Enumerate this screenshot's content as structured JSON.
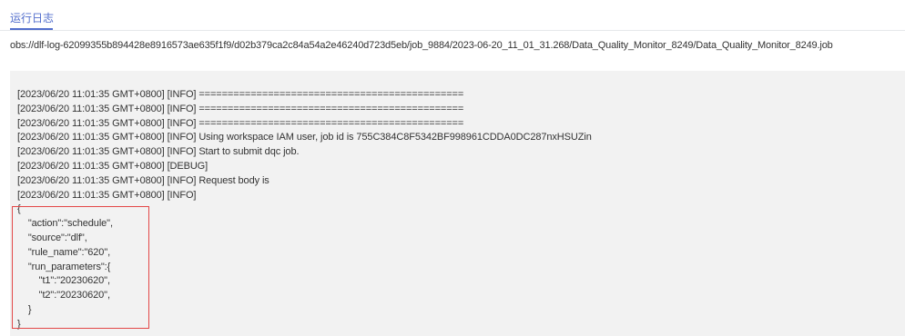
{
  "tabs": {
    "active_label": "运行日志"
  },
  "log_path": "obs://dlf-log-62099355b894428e8916573ae635f1f9/d02b379ca2c84a54a2e46240d723d5eb/job_9884/2023-06-20_11_01_31.268/Data_Quality_Monitor_8249/Data_Quality_Monitor_8249.job",
  "log_lines": [
    "[2023/06/20 11:01:35 GMT+0800] [INFO] ==============================================",
    "[2023/06/20 11:01:35 GMT+0800] [INFO] ==============================================",
    "[2023/06/20 11:01:35 GMT+0800] [INFO] ==============================================",
    "[2023/06/20 11:01:35 GMT+0800] [INFO] Using workspace IAM user, job id is 755C384C8F5342BF998961CDDA0DC287nxHSUZin",
    "[2023/06/20 11:01:35 GMT+0800] [INFO] Start to submit dqc job.",
    "[2023/06/20 11:01:35 GMT+0800] [DEBUG]",
    "[2023/06/20 11:01:35 GMT+0800] [INFO] Request body is",
    "[2023/06/20 11:01:35 GMT+0800] [INFO]",
    "{",
    "    \"action\":\"schedule\",",
    "    \"source\":\"dlf\",",
    "    \"rule_name\":\"620\",",
    "    \"run_parameters\":{",
    "        \"t1\":\"20230620\",",
    "        \"t2\":\"20230620\",",
    "    }",
    "}"
  ],
  "colors": {
    "accent": "#526ecc",
    "highlight_border": "#e34848",
    "log_background": "#f2f2f2",
    "text": "#333333"
  }
}
